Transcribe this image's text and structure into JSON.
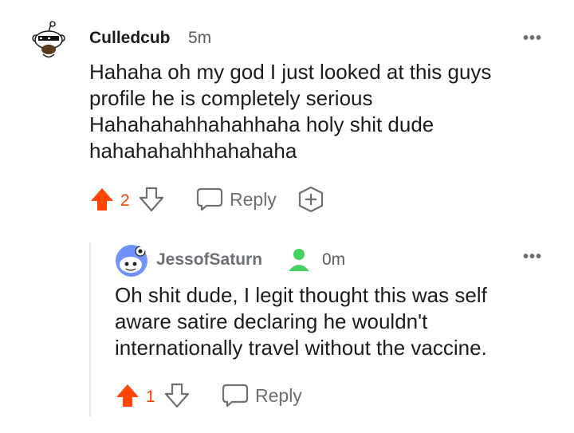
{
  "comments": [
    {
      "username": "Culledcub",
      "time": "5m",
      "more": "•••",
      "lines": [
        "Hahaha oh my god I just looked at this guys",
        "profile he is completely serious",
        "Hahahahahhahahhaha holy shit dude",
        "hahahahahhhahahaha"
      ],
      "votes": "2",
      "reply_label": "Reply",
      "upvoted": true
    },
    {
      "username": "JessofSaturn",
      "time": "0m",
      "more": "•••",
      "lines": [
        "Oh shit dude, I legit thought this was self",
        "aware satire declaring he wouldn't",
        "internationally travel without the vaccine."
      ],
      "votes": "1",
      "reply_label": "Reply",
      "upvoted": true
    }
  ],
  "colors": {
    "upvote": "#ff4500",
    "icon_gray": "#6c6f73",
    "online_green": "#46d160",
    "reply_username": "#6c6f73"
  },
  "icons": {
    "upvote": "arrow-up-icon",
    "downvote": "arrow-down-icon",
    "reply": "speech-bubble-icon",
    "award": "award-plus-icon",
    "online": "user-online-icon"
  }
}
